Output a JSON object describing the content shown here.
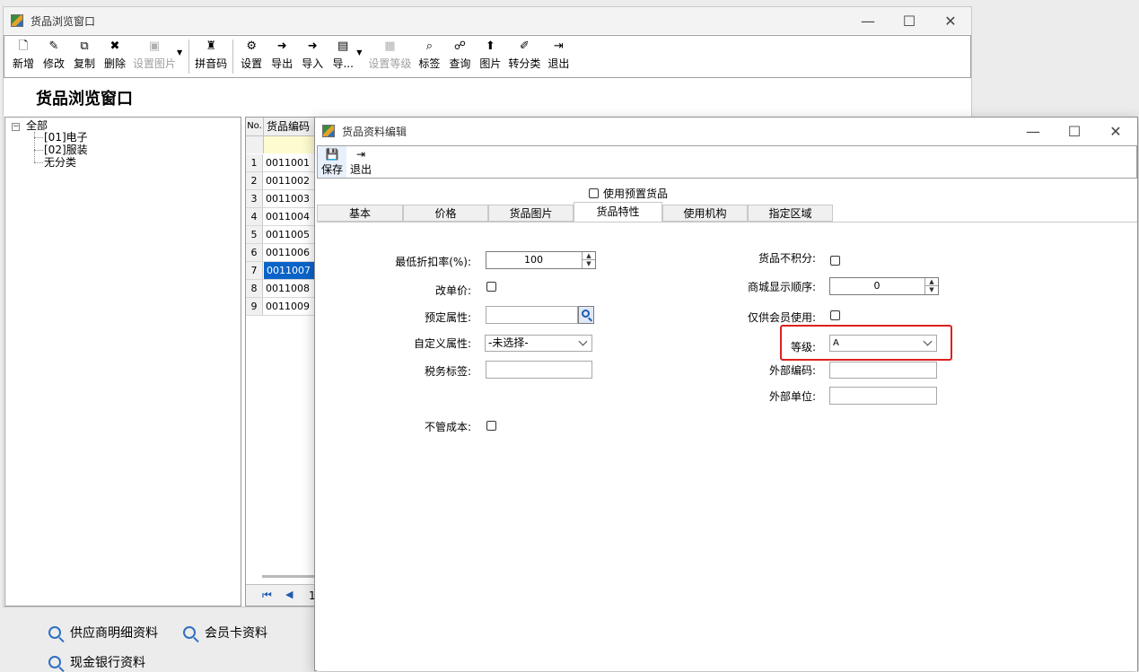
{
  "main_window": {
    "title": "货品浏览窗口",
    "heading": "货品浏览窗口",
    "controls": {
      "minimize": "—",
      "maximize": "☐",
      "close": "✕"
    },
    "toolbar": [
      {
        "name": "new-button",
        "label": "新增",
        "icon": "new-document-icon",
        "glyph": "🗋",
        "enabled": true
      },
      {
        "name": "edit-button",
        "label": "修改",
        "icon": "edit-icon",
        "glyph": "✎",
        "enabled": true
      },
      {
        "name": "copy-button",
        "label": "复制",
        "icon": "copy-icon",
        "glyph": "⧉",
        "enabled": true
      },
      {
        "name": "delete-button",
        "label": "删除",
        "icon": "delete-icon",
        "glyph": "✖",
        "enabled": true
      },
      {
        "name": "set-image-button",
        "label": "设置图片",
        "icon": "image-icon",
        "glyph": "▣",
        "enabled": false,
        "dropdown": true
      },
      {
        "name": "pinyin-button",
        "label": "拼音码",
        "icon": "pinyin-icon",
        "glyph": "♜",
        "enabled": true,
        "sep_before": true
      },
      {
        "name": "settings-button",
        "label": "设置",
        "icon": "settings-icon",
        "glyph": "⚙",
        "enabled": true,
        "sep_before": true
      },
      {
        "name": "export-button",
        "label": "导出",
        "icon": "export-icon",
        "glyph": "➜",
        "enabled": true
      },
      {
        "name": "import-button",
        "label": "导入",
        "icon": "import-icon",
        "glyph": "➜",
        "enabled": true
      },
      {
        "name": "more-button",
        "label": "导...",
        "icon": "report-icon",
        "glyph": "▤",
        "enabled": true,
        "dropdown": true
      },
      {
        "name": "set-level-button",
        "label": "设置等级",
        "icon": "grid-icon",
        "glyph": "▦",
        "enabled": false
      },
      {
        "name": "tag-button",
        "label": "标签",
        "icon": "tag-icon",
        "glyph": "⌕",
        "enabled": true
      },
      {
        "name": "query-button",
        "label": "查询",
        "icon": "binoculars-icon",
        "glyph": "☍",
        "enabled": true
      },
      {
        "name": "picture-button",
        "label": "图片",
        "icon": "picture-icon",
        "glyph": "⬆",
        "enabled": true
      },
      {
        "name": "reclassify-button",
        "label": "转分类",
        "icon": "broom-icon",
        "glyph": "✐",
        "enabled": true
      },
      {
        "name": "exit-button",
        "label": "退出",
        "icon": "exit-icon",
        "glyph": "⇥",
        "enabled": true
      }
    ],
    "tree": {
      "root": "全部",
      "children": [
        "[01]电子",
        "[02]服装",
        "无分类"
      ]
    },
    "grid": {
      "headers": {
        "no": "No.",
        "code": "货品编码"
      },
      "rows": [
        {
          "no": "1",
          "code": "0011001"
        },
        {
          "no": "2",
          "code": "0011002"
        },
        {
          "no": "3",
          "code": "0011003"
        },
        {
          "no": "4",
          "code": "0011004"
        },
        {
          "no": "5",
          "code": "0011005"
        },
        {
          "no": "6",
          "code": "0011006"
        },
        {
          "no": "7",
          "code": "0011007",
          "selected": true
        },
        {
          "no": "8",
          "code": "0011008"
        },
        {
          "no": "9",
          "code": "0011009"
        }
      ],
      "pager_page": "1"
    }
  },
  "background_shortcuts": [
    {
      "label": "供应商明细资料",
      "icon": "search-icon"
    },
    {
      "label": "会员卡资料",
      "icon": "search-icon"
    },
    {
      "label": "现金银行资料",
      "icon": "search-icon"
    }
  ],
  "dialog": {
    "title": "货品资料编辑",
    "controls": {
      "minimize": "—",
      "maximize": "☐",
      "close": "✕"
    },
    "toolbar": [
      {
        "name": "save-button",
        "label": "保存",
        "icon": "save-icon",
        "glyph": "💾"
      },
      {
        "name": "dialog-exit-button",
        "label": "退出",
        "icon": "exit-icon",
        "glyph": "⇥"
      }
    ],
    "use_preset_label": "使用预置货品",
    "tabs": [
      "基本",
      "价格",
      "货品图片",
      "货品特性",
      "使用机构",
      "指定区域"
    ],
    "active_tab": 3,
    "fields_left": {
      "min_discount_label": "最低折扣率(%):",
      "min_discount_value": "100",
      "change_price_label": "改单价:",
      "preset_attr_label": "预定属性:",
      "preset_attr_value": "",
      "custom_attr_label": "自定义属性:",
      "custom_attr_value": "-未选择-",
      "tax_tag_label": "税务标签:",
      "tax_tag_value": "",
      "no_cost_label": "不管成本:"
    },
    "fields_right": {
      "no_points_label": "货品不积分:",
      "display_order_label": "商城显示顺序:",
      "display_order_value": "0",
      "member_only_label": "仅供会员使用:",
      "level_label": "等级:",
      "level_value": "A",
      "ext_code_label": "外部编码:",
      "ext_code_value": "",
      "ext_unit_label": "外部单位:",
      "ext_unit_value": ""
    },
    "highlight_color": "#e02020"
  }
}
